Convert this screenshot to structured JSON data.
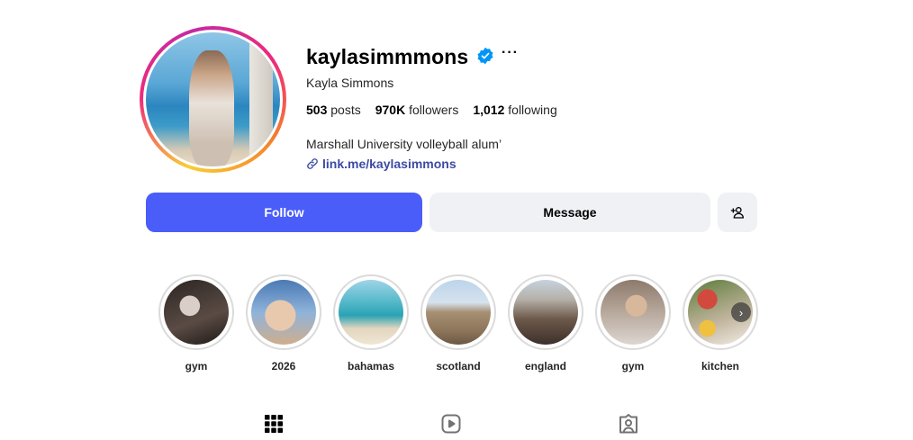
{
  "profile": {
    "username": "kaylasimmmons",
    "full_name": "Kayla Simmons",
    "more_label": "···",
    "stats": {
      "posts_count": "503",
      "posts_label": "posts",
      "followers_count": "970K",
      "followers_label": "followers",
      "following_count": "1,012",
      "following_label": "following"
    },
    "bio": "Marshall University volleyball alum’",
    "link": "link.me/kaylasimmons"
  },
  "actions": {
    "follow_label": "Follow",
    "message_label": "Message"
  },
  "highlights": [
    {
      "label": "gym"
    },
    {
      "label": "2026"
    },
    {
      "label": "bahamas"
    },
    {
      "label": "scotland"
    },
    {
      "label": "england"
    },
    {
      "label": "gym"
    },
    {
      "label": "kitchen"
    }
  ],
  "icons": {
    "verified": "verified-badge-icon",
    "link": "link-icon",
    "add_user": "add-user-icon",
    "next": "chevron-right-icon",
    "posts_tab": "grid-icon",
    "reels_tab": "reels-icon",
    "tagged_tab": "tagged-icon"
  },
  "colors": {
    "follow_button": "#4a5df9",
    "secondary_button": "#eff1f4",
    "verified": "#0095f6",
    "link": "#3b4ba3"
  }
}
